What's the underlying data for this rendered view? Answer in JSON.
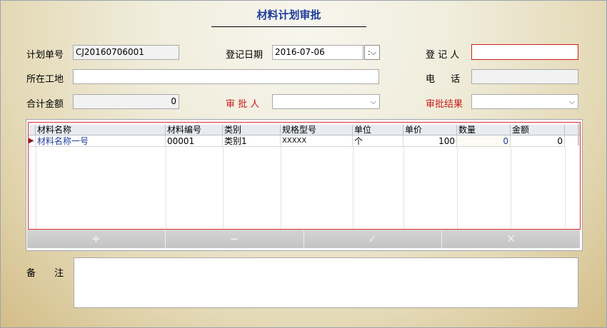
{
  "header": {
    "title": "材料计划审批"
  },
  "form": {
    "plan_no": {
      "label": "计划单号",
      "value": "CJ20160706001"
    },
    "reg_date": {
      "label": "登记日期",
      "value": "2016-07-06",
      "picker": ":"
    },
    "registrant": {
      "label": "登 记 人",
      "value": ""
    },
    "site": {
      "label": "所在工地",
      "value": ""
    },
    "phone": {
      "label": "电 话",
      "value": ""
    },
    "total": {
      "label": "合计金额",
      "value": "0"
    },
    "approver": {
      "label": "审 批 人",
      "value": ""
    },
    "result": {
      "label": "审批结果",
      "value": ""
    }
  },
  "grid": {
    "columns": [
      "材料名称",
      "材料编号",
      "类别",
      "规格型号",
      "单位",
      "单价",
      "数量",
      "金额"
    ],
    "rows": [
      {
        "name": "材料名称一号",
        "code": "00001",
        "category": "类别1",
        "spec": "XXXXX",
        "unit": "个",
        "price": "100",
        "qty": "0",
        "amount": "0"
      }
    ]
  },
  "toolbar": {
    "add": "+",
    "remove": "−",
    "confirm": "✓",
    "delete": "✕"
  },
  "notes": {
    "label": "备 注",
    "value": ""
  },
  "icons": {
    "dropdown": "chevron-down-icon",
    "row_pointer": "triangle-right-icon"
  },
  "colors": {
    "title": "#1f3d9a",
    "required_label": "#cc1a1a"
  }
}
